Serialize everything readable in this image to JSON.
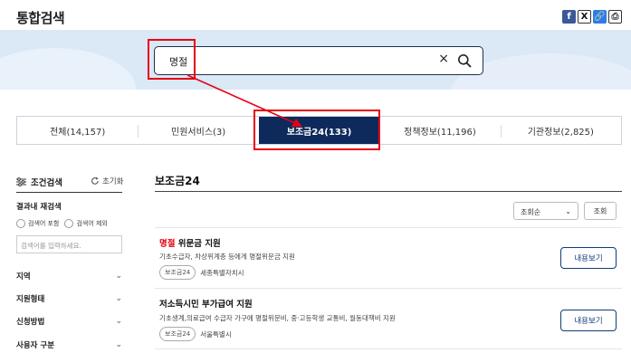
{
  "header": {
    "title": "통합검색",
    "share": [
      {
        "icon": "facebook-icon",
        "glyph": "f"
      },
      {
        "icon": "x-twitter-icon",
        "glyph": "X"
      },
      {
        "icon": "link-icon",
        "glyph": "🔗"
      },
      {
        "icon": "print-icon",
        "glyph": "⎙"
      }
    ]
  },
  "search": {
    "value": "명절",
    "clear_glyph": "×",
    "border_color": "#1f2f4a"
  },
  "tabs": [
    {
      "label": "전체(14,157)"
    },
    {
      "label": "민원서비스(3)"
    },
    {
      "label": "보조금24(133)",
      "active": true
    },
    {
      "label": "정책정보(11,196)"
    },
    {
      "label": "기관정보(2,825)"
    }
  ],
  "sidebar": {
    "filter_title": "조건검색",
    "reset_label": "초기화",
    "refine_title": "결과내 재검색",
    "radio_include": "검색어 포함",
    "radio_exclude": "검색어 제외",
    "refine_placeholder": "검색어를 입력하세요.",
    "facets": [
      "지역",
      "지원형태",
      "신청방법",
      "사용자 구분"
    ]
  },
  "main": {
    "section_title": "보조금24",
    "sort_selected": "조회순",
    "sort_button": "조회",
    "results": [
      {
        "title_highlight": "명절",
        "title_rest": " 위문금 지원",
        "description": "기초수급자, 차상위계층 등에게 명절위문금 지원",
        "tag": "보조금24",
        "agency": "세종특별자치시",
        "button": "내용보기"
      },
      {
        "title_highlight": "",
        "title_rest": "저소득시민 부가급여 지원",
        "description": "기초생계,의료급여 수급자 가구에 명절위문비, 중·고등학생 교통비, 월동대책비 지원",
        "tag": "보조금24",
        "agency": "서울특별시",
        "button": "내용보기"
      }
    ]
  },
  "colors": {
    "accent_navy": "#0e2a5c",
    "highlight_red": "#e60012",
    "band": "#dbe8f5"
  }
}
